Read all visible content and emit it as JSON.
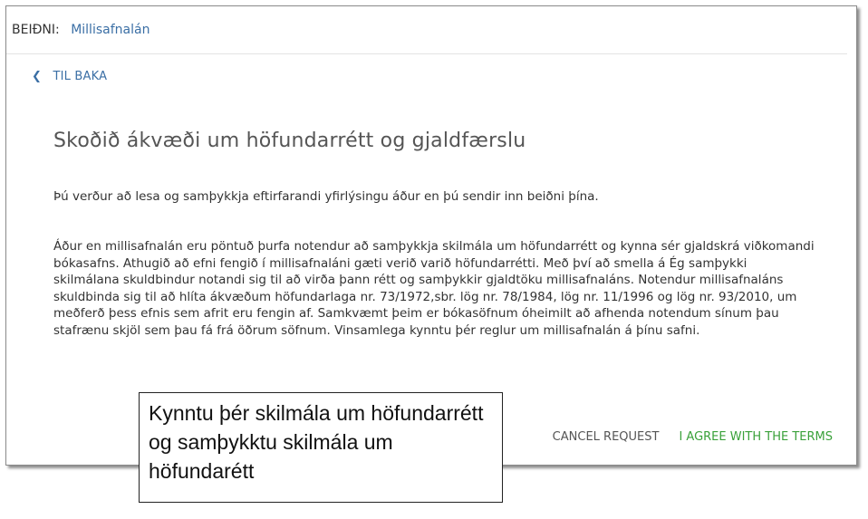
{
  "header": {
    "label": "BEIÐNI:",
    "value": "Millisafnalán"
  },
  "back_link": {
    "icon": "chevron-left-icon",
    "label": "TIL BAKA"
  },
  "page_title": "Skoðið ákvæði um höfundarrétt og gjaldfærslu",
  "intro_text": "Þú verður að lesa og samþykkja eftirfarandi yfirlýsingu áður en þú sendir inn beiðni þína.",
  "terms_text": "Áður en millisafnalán eru pöntuð þurfa notendur að samþykkja skilmála um höfundarrétt og kynna sér gjaldskrá viðkomandi bókasafns. Athugið að efni fengið í millisafnaláni gæti verið varið höfundarrétti. Með því að smella á Ég samþykki skilmálana skuldbindur notandi sig til að virða þann rétt og samþykkir gjaldtöku millisafnaláns. Notendur millisafnaláns skuldbinda sig til að hlíta ákvæðum höfundarlaga nr. 73/1972,sbr. lög nr. 78/1984, lög nr. 11/1996 og lög nr. 93/2010, um meðferð þess efnis sem afrit eru fengin af. Samkvæmt þeim er bókasöfnum óheimilt að afhenda notendum sínum þau stafrænu skjöl sem þau fá frá öðrum söfnum. Vinsamlega kynntu þér reglur um millisafnalán á þínu safni.",
  "actions": {
    "cancel_label": "CANCEL REQUEST",
    "agree_label": "I AGREE WITH THE TERMS"
  },
  "callout_text": "Kynntu þér skilmála um höfundarrétt og samþykktu skilmála um höfundarétt",
  "colors": {
    "link": "#3b6fa5",
    "agree": "#3aa13a",
    "title": "#555555"
  }
}
